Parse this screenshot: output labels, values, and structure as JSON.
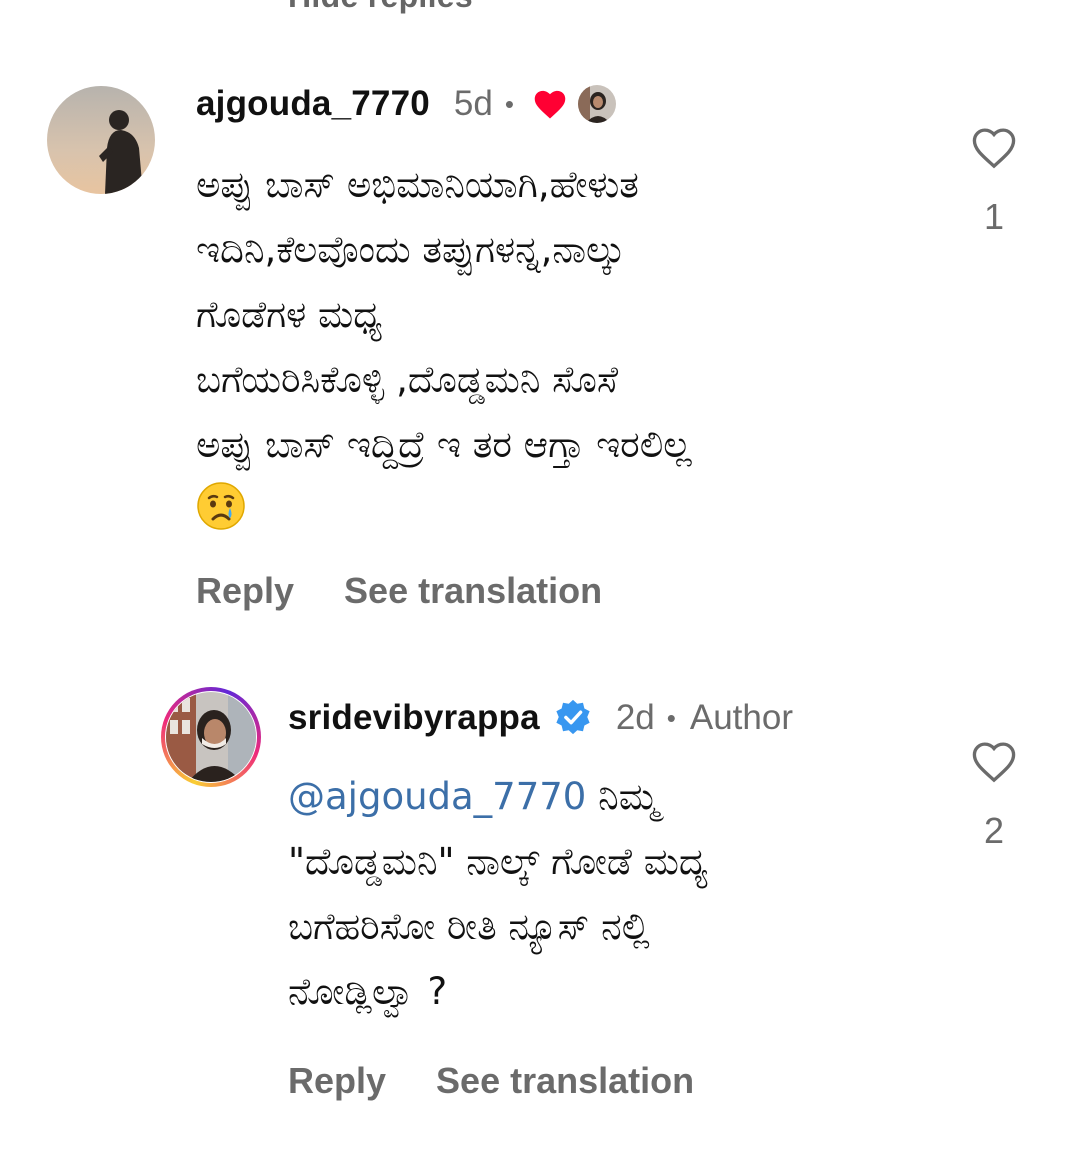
{
  "top": {
    "hide_replies_label": "Hide replies"
  },
  "comments": [
    {
      "username": "ajgouda_7770",
      "time": "5d",
      "separator": "•",
      "lines": [
        "ಅಪ್ಪು ಬಾಸ್ ಅಭಿಮಾನಿಯಾಗಿ,ಹೇಳುತ",
        "ಇದಿನಿ,ಕೆಲವೊಂದು ತಪ್ಪುಗಳನ್ನ,ನಾಲ್ಕು",
        "ಗೊಡೆಗಳ ಮಧ್ಯ",
        "ಬಗೆಯರಿಸಿಕೊಳ್ಳಿ ,ದೊಡ್ಡಮನಿ ಸೊಸೆ",
        "ಅಪ್ಪು ಬಾಸ್ ಇದ್ದಿದ್ರೆ ಇ ತರ ಆಗ್ತಾ ಇರಲಿಲ್ಲ"
      ],
      "reply_label": "Reply",
      "translate_label": "See translation",
      "like_count": "1",
      "liked_by_author_icon": "heart-icon",
      "heart_color": "#ff0033"
    },
    {
      "username": "sridevibyrappa",
      "time": "2d",
      "separator": "•",
      "author_label": "Author",
      "mention": "@ajgouda_7770",
      "lines": [
        " ನಿಮ್ಮ",
        "\"ದೊಡ್ಡಮನಿ\" ನಾಲ್ಕ್ ಗೋಡೆ ಮದ್ಯ",
        "ಬಗೆಹರಿಸೋ ರೀತಿ ನ್ಯೂಸ್ ನಲ್ಲಿ",
        "ನೋಡ್ಲಿಲ್ವಾ ?"
      ],
      "reply_label": "Reply",
      "translate_label": "See translation",
      "like_count": "2",
      "verified_color": "#3897f0"
    }
  ],
  "colors": {
    "mention": "#3c6fa8",
    "secondary_text": "#6b6b6b"
  }
}
